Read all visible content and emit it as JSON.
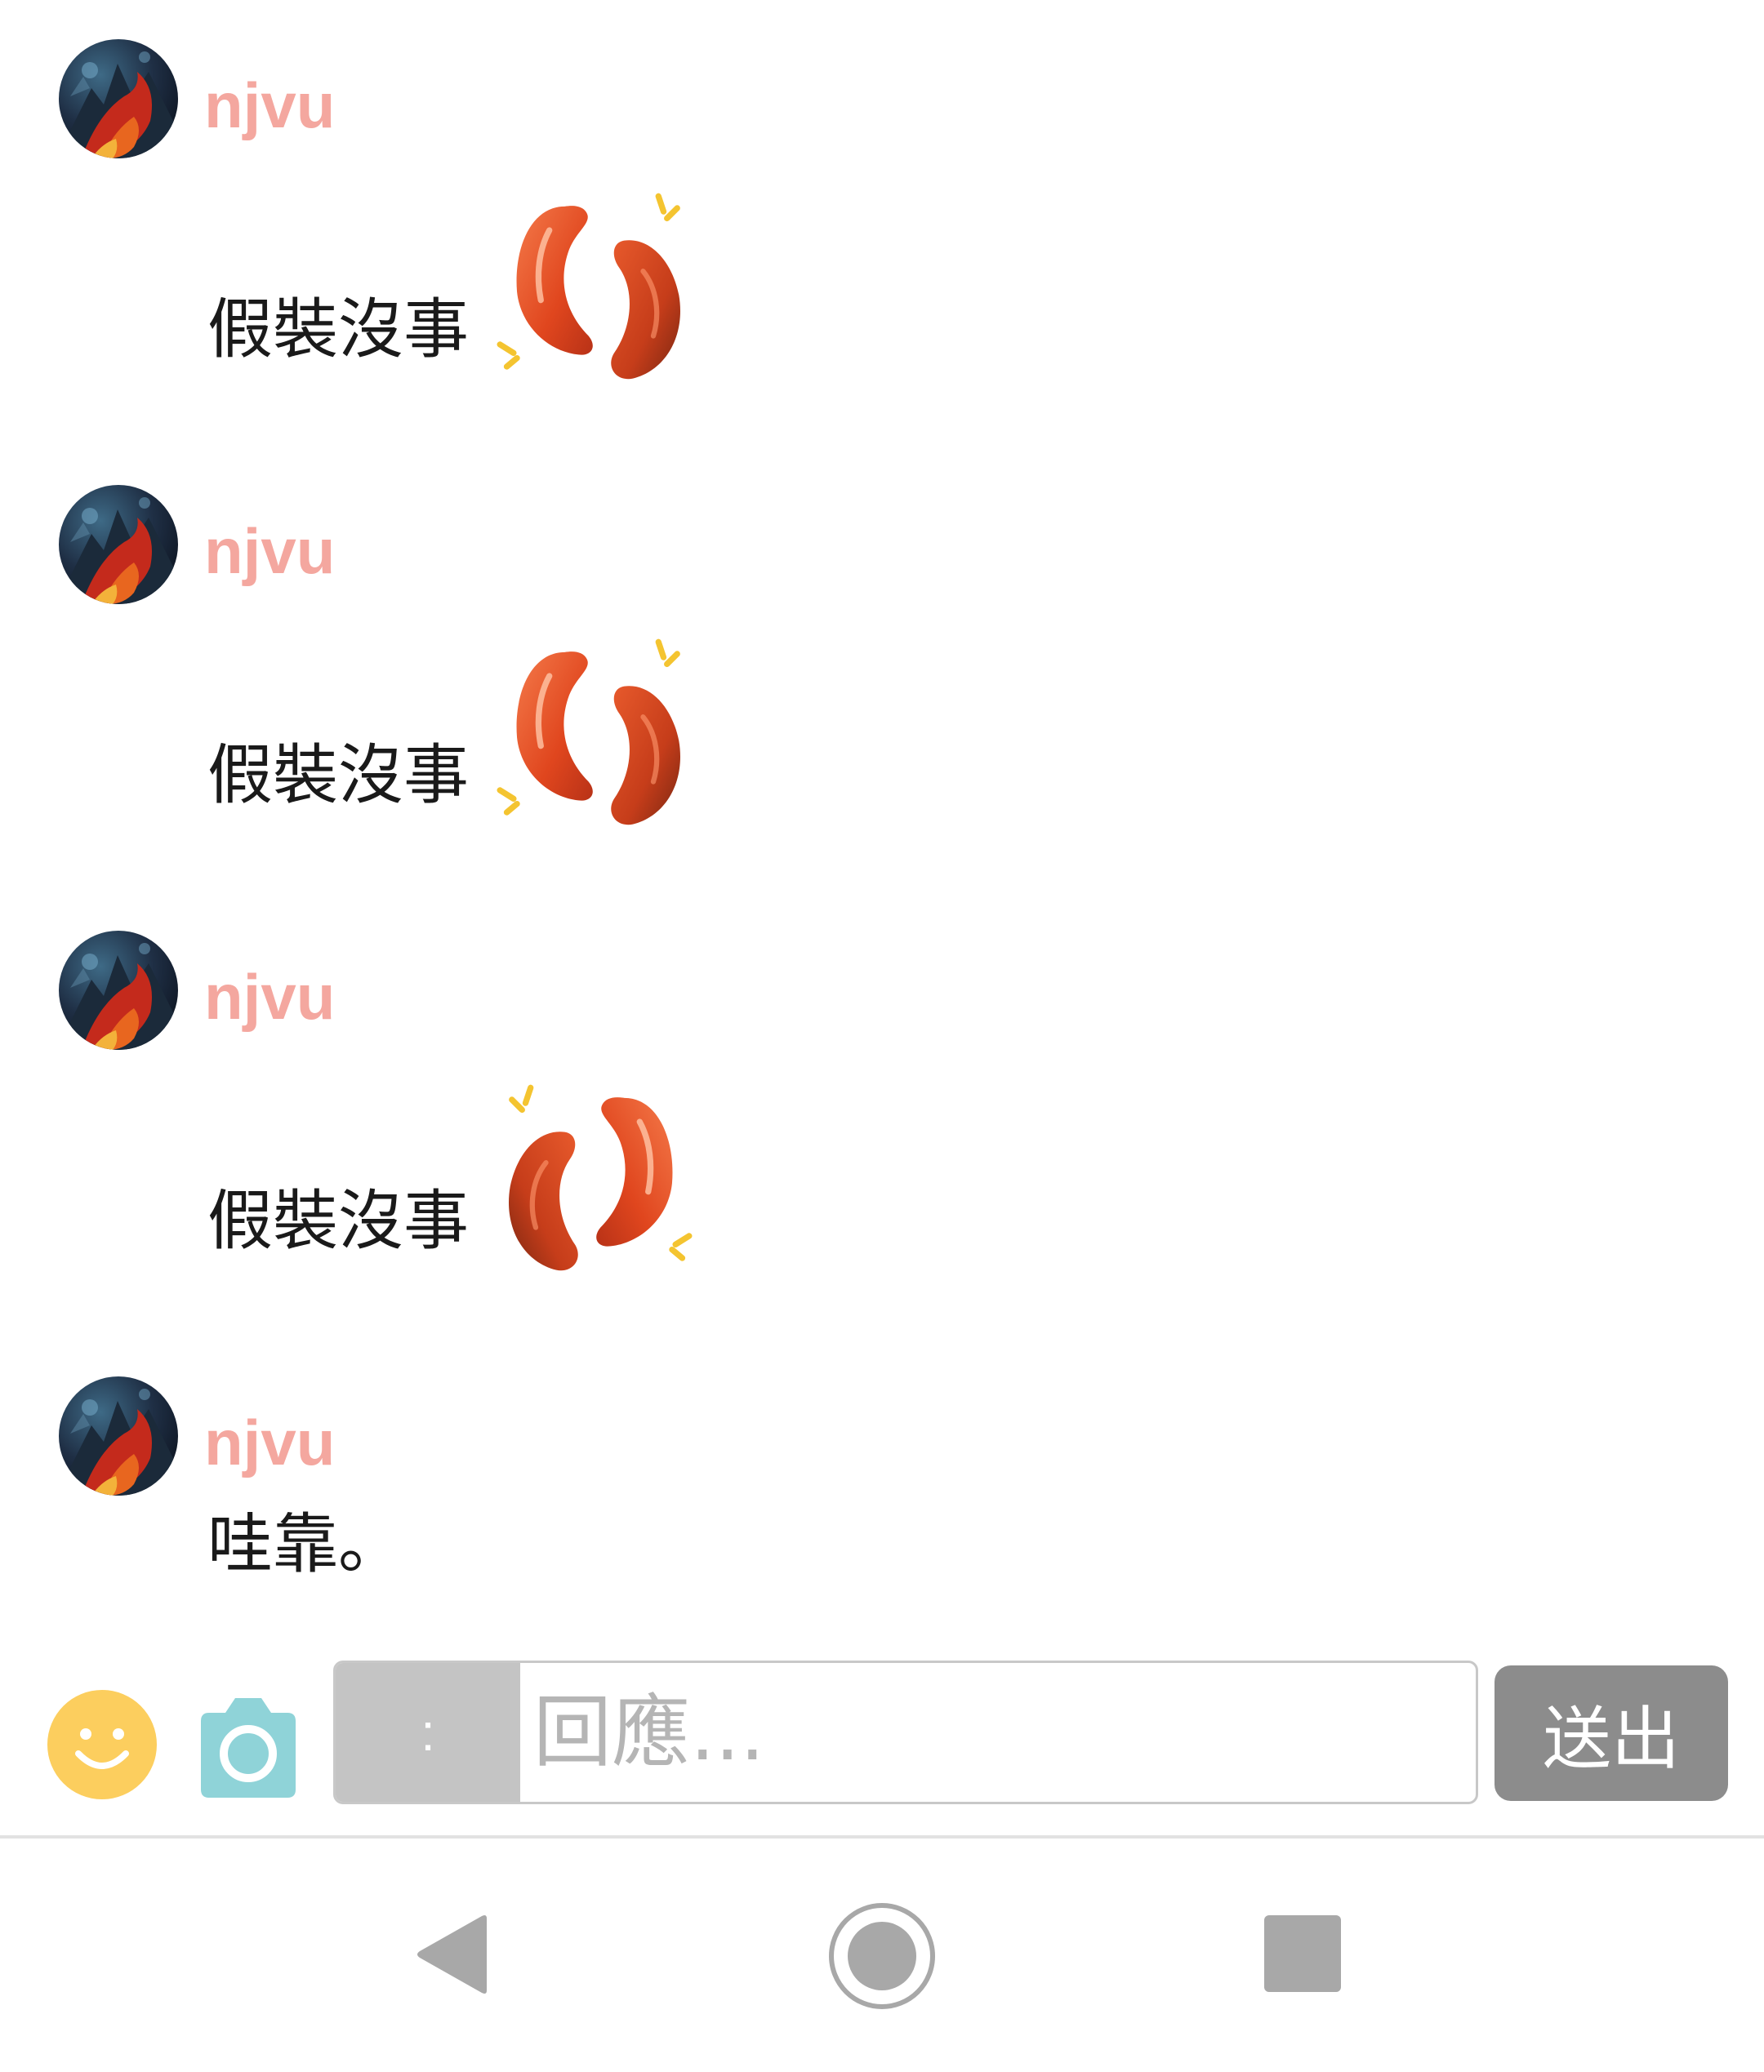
{
  "theme": {
    "username_color": "#f4a79f",
    "text_color": "#1a1a1a",
    "smiley_color": "#fcce5e",
    "camera_color": "#8fd3d8",
    "send_button_color": "#8c8c8c",
    "nav_icon_color": "#a8a8a8"
  },
  "messages": [
    {
      "username": "njvu",
      "text": "假裝沒事",
      "sticker": "bean-sticker"
    },
    {
      "username": "njvu",
      "text": "假裝沒事",
      "sticker": "bean-sticker"
    },
    {
      "username": "njvu",
      "text": "假裝沒事",
      "sticker": "bean-sticker"
    },
    {
      "username": "njvu",
      "text": "哇靠。"
    }
  ],
  "composer": {
    "smiley_icon": "smiley-icon",
    "camera_icon": "camera-icon",
    "reply_prefix": ":",
    "reply_placeholder": "回應...",
    "send_label": "送出"
  },
  "navbar": {
    "back_icon": "back-triangle-icon",
    "home_icon": "home-circle-icon",
    "recents_icon": "recents-square-icon"
  }
}
